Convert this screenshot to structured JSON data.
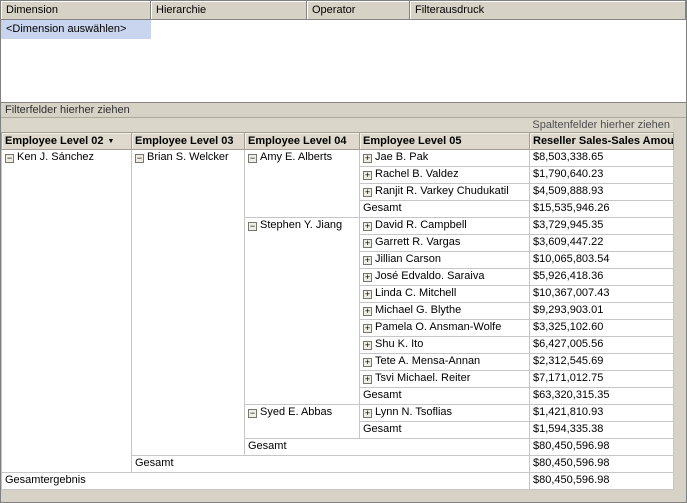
{
  "colors": {
    "selection": "#c9d5ef",
    "window_bg": "#d6d2c6",
    "pivot_header_bg": "#ded9cc"
  },
  "filter_grid": {
    "headers": [
      "Dimension",
      "Hierarchie",
      "Operator",
      "Filterausdruck"
    ],
    "selected_row_label": "<Dimension auswählen>"
  },
  "drop_zones": {
    "filter_fields_label": "Filterfelder hierher ziehen",
    "column_fields_label": "Spaltenfelder hierher ziehen"
  },
  "pivot": {
    "columns": [
      {
        "label": "Employee Level 02",
        "dropdown": true
      },
      {
        "label": "Employee Level 03",
        "dropdown": false
      },
      {
        "label": "Employee Level 04",
        "dropdown": false
      },
      {
        "label": "Employee Level 05",
        "dropdown": false
      },
      {
        "label": "Reseller Sales-Sales Amount",
        "dropdown": false
      }
    ],
    "rows": [
      {
        "cells": [
          {
            "text": "Ken J. Sánchez",
            "expander": "collapse",
            "rowspan": 19
          },
          {
            "text": "Brian S. Welcker",
            "expander": "collapse",
            "rowspan": 18
          },
          {
            "text": "Amy E. Alberts",
            "expander": "collapse",
            "rowspan": 4
          },
          {
            "text": "Jae B. Pak",
            "expander": "expand"
          },
          {
            "text": "$8,503,338.65",
            "type": "value"
          }
        ]
      },
      {
        "cells": [
          {
            "text": "Rachel B. Valdez",
            "expander": "expand"
          },
          {
            "text": "$1,790,640.23",
            "type": "value"
          }
        ]
      },
      {
        "cells": [
          {
            "text": "Ranjit R. Varkey Chudukatil",
            "expander": "expand"
          },
          {
            "text": "$4,509,888.93",
            "type": "value"
          }
        ]
      },
      {
        "cells": [
          {
            "text": "Gesamt",
            "type": "total"
          },
          {
            "text": "$15,535,946.26",
            "type": "value"
          }
        ]
      },
      {
        "cells": [
          {
            "text": "Stephen Y. Jiang",
            "expander": "collapse",
            "rowspan": 11
          },
          {
            "text": "David R. Campbell",
            "expander": "expand"
          },
          {
            "text": "$3,729,945.35",
            "type": "value"
          }
        ]
      },
      {
        "cells": [
          {
            "text": "Garrett R. Vargas",
            "expander": "expand"
          },
          {
            "text": "$3,609,447.22",
            "type": "value"
          }
        ]
      },
      {
        "cells": [
          {
            "text": "Jillian Carson",
            "expander": "expand"
          },
          {
            "text": "$10,065,803.54",
            "type": "value"
          }
        ]
      },
      {
        "cells": [
          {
            "text": "José Edvaldo. Saraiva",
            "expander": "expand"
          },
          {
            "text": "$5,926,418.36",
            "type": "value"
          }
        ]
      },
      {
        "cells": [
          {
            "text": "Linda C. Mitchell",
            "expander": "expand"
          },
          {
            "text": "$10,367,007.43",
            "type": "value"
          }
        ]
      },
      {
        "cells": [
          {
            "text": "Michael G. Blythe",
            "expander": "expand"
          },
          {
            "text": "$9,293,903.01",
            "type": "value"
          }
        ]
      },
      {
        "cells": [
          {
            "text": "Pamela O. Ansman-Wolfe",
            "expander": "expand"
          },
          {
            "text": "$3,325,102.60",
            "type": "value"
          }
        ]
      },
      {
        "cells": [
          {
            "text": "Shu K. Ito",
            "expander": "expand"
          },
          {
            "text": "$6,427,005.56",
            "type": "value"
          }
        ]
      },
      {
        "cells": [
          {
            "text": "Tete A. Mensa-Annan",
            "expander": "expand"
          },
          {
            "text": "$2,312,545.69",
            "type": "value"
          }
        ]
      },
      {
        "cells": [
          {
            "text": "Tsvi Michael. Reiter",
            "expander": "expand"
          },
          {
            "text": "$7,171,012.75",
            "type": "value"
          }
        ]
      },
      {
        "cells": [
          {
            "text": "Gesamt",
            "type": "total"
          },
          {
            "text": "$63,320,315.35",
            "type": "value"
          }
        ]
      },
      {
        "cells": [
          {
            "text": "Syed E. Abbas",
            "expander": "collapse",
            "rowspan": 2
          },
          {
            "text": "Lynn N. Tsoflias",
            "expander": "expand"
          },
          {
            "text": "$1,421,810.93",
            "type": "value"
          }
        ]
      },
      {
        "cells": [
          {
            "text": "Gesamt",
            "type": "total"
          },
          {
            "text": "$1,594,335.38",
            "type": "value"
          }
        ]
      },
      {
        "cells": [
          {
            "text": "Gesamt",
            "type": "total",
            "colspan": 2
          },
          {
            "text": "$80,450,596.98",
            "type": "value"
          }
        ]
      },
      {
        "cells": [
          {
            "text": "Gesamt",
            "type": "total",
            "colspan": 3
          },
          {
            "text": "$80,450,596.98",
            "type": "value"
          }
        ]
      },
      {
        "cells": [
          {
            "text": "Gesamtergebnis",
            "type": "total",
            "colspan": 4
          },
          {
            "text": "$80,450,596.98",
            "type": "value"
          }
        ]
      }
    ]
  }
}
